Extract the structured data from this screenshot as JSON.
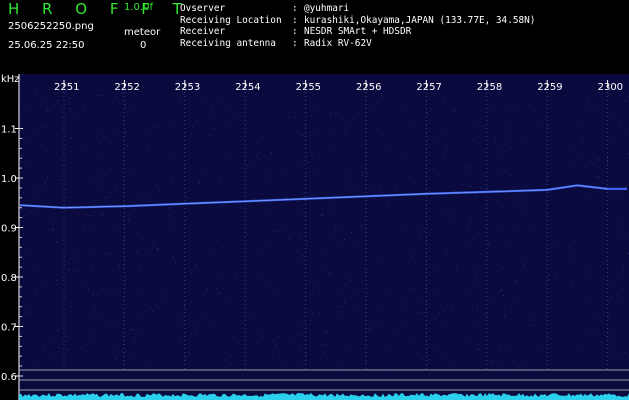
{
  "header": {
    "logo": "H R O F F T",
    "version": "1.0.0f",
    "filename": "2506252250.png",
    "meteor_label": "meteor",
    "datetime": "25.06.25 22:50",
    "meteor_count": "0"
  },
  "info": [
    {
      "label": "Ovserver",
      "value": "@yuhmari"
    },
    {
      "label": "Receiving Location",
      "value": "kurashiki,Okayama,JAPAN (133.77E, 34.58N)"
    },
    {
      "label": "Receiver",
      "value": "NESDR SMArt + HDSDR"
    },
    {
      "label": "Receiving antenna",
      "value": "Radix RV-62V"
    }
  ],
  "chart_data": {
    "type": "heatmap",
    "title": "",
    "ylabel": "kHz",
    "xlabel": "",
    "x_ticks": [
      "2251",
      "2252",
      "2253",
      "2254",
      "2255",
      "2256",
      "2257",
      "2258",
      "2259",
      "2300"
    ],
    "y_ticks": [
      "1.1",
      "1.0",
      "0.9",
      "0.8",
      "0.7",
      "0.6"
    ],
    "ylim": [
      0.58,
      1.12
    ],
    "series": [
      {
        "x": [
          "2250",
          "2251",
          "2252",
          "2253",
          "2254",
          "2255",
          "2256",
          "2257",
          "2258",
          "2259",
          "2259.5",
          "2300"
        ],
        "values": [
          0.945,
          0.94,
          0.943,
          0.948,
          0.953,
          0.958,
          0.963,
          0.968,
          0.972,
          0.976,
          0.985,
          0.978
        ]
      }
    ],
    "colors": {
      "background": "#0a0a3e",
      "trace": "#3f6bff",
      "noise_band": "#2ee6ff",
      "reference_lines": "#bfbfbf"
    }
  }
}
